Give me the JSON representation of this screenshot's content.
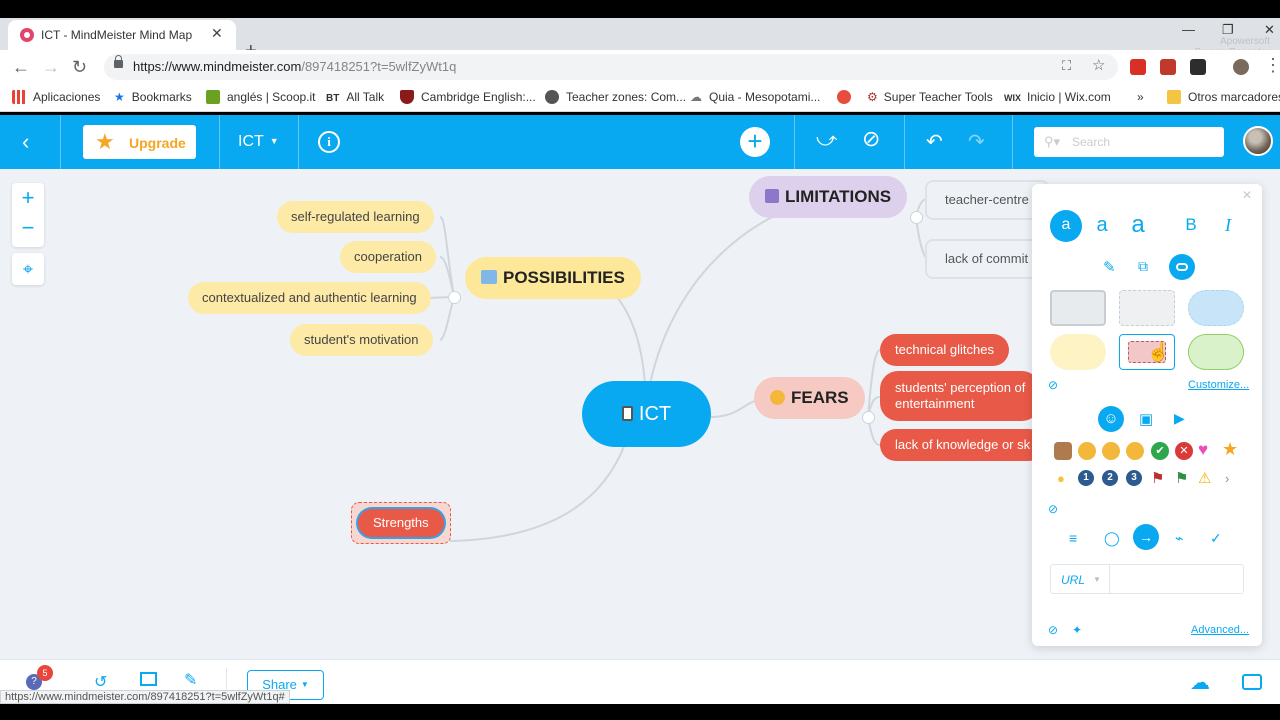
{
  "browser": {
    "tab_title": "ICT - MindMeister Mind Map",
    "url": "https://www.mindmeister.com/897418251?t=5wlfZyWt1q",
    "url_host": "https://www.mindmeister.com",
    "url_path": "/897418251?t=5wlfZyWt1q",
    "status_url": "https://www.mindmeister.com/897418251?t=5wlfZyWt1q#",
    "recorder_line1": "Apowersoft",
    "recorder_line2": "Screen Recorder",
    "bookmarks": [
      {
        "label": "Aplicaciones",
        "icon": "apps-grid-icon",
        "color": "#ea4335"
      },
      {
        "label": "Bookmarks",
        "icon": "star-icon",
        "color": "#1a73e8"
      },
      {
        "label": "anglés | Scoop.it",
        "icon": "scoopit-icon",
        "color": "#6aa121"
      },
      {
        "label": "All Talk",
        "icon": "bt-icon",
        "color": "#222222"
      },
      {
        "label": "Cambridge English:...",
        "icon": "cambridge-shield-icon",
        "color": "#8b1a1a"
      },
      {
        "label": "Teacher zones: Com...",
        "icon": "globe-icon",
        "color": "#555555"
      },
      {
        "label": "Quia - Mesopotami...",
        "icon": "quia-icon",
        "color": "#777777"
      },
      {
        "label": "",
        "icon": "play-icon",
        "color": "#e84c3d"
      },
      {
        "label": "Super Teacher Tools",
        "icon": "gear-icon",
        "color": "#a33"
      },
      {
        "label": "Inicio | Wix.com",
        "icon": "wix-icon",
        "color": "#000000"
      }
    ],
    "more_bookmarks": "»",
    "other_bookmarks": "Otros marcadores"
  },
  "app": {
    "upgrade_label": "Upgrade",
    "map_name": "ICT",
    "info_label": "i",
    "search_placeholder": "Search",
    "brand_color": "#09a9f1"
  },
  "map": {
    "root": "ICT",
    "possibilities": {
      "label": "POSSIBILITIES",
      "children": [
        "self-regulated learning",
        "cooperation",
        "contextualized and authentic learning",
        "student's motivation"
      ]
    },
    "limitations": {
      "label": "LIMITATIONS",
      "children": [
        "teacher-centre",
        "lack of commit"
      ]
    },
    "fears": {
      "label": "FEARS",
      "children": [
        "technical glitches",
        "students' perception of",
        "entertainment",
        "lack of knowledge or sk"
      ]
    },
    "strengths": "Strengths"
  },
  "panel": {
    "font_sizes": [
      "a",
      "a",
      "a"
    ],
    "bold_label": "B",
    "italic_label": "I",
    "customize_label": "Customize...",
    "url_label": "URL",
    "url_value": "",
    "advanced_label": "Advanced...",
    "number_icons": [
      "1",
      "2",
      "3"
    ]
  },
  "footer": {
    "share_label": "Share",
    "notification_count": "5"
  }
}
